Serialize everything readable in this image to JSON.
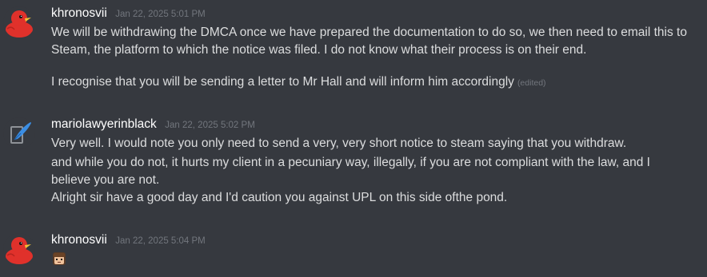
{
  "messages": [
    {
      "username": "khronosvii",
      "timestamp": "Jan 22, 2025 5:01 PM",
      "avatar_icon": "red-duck-icon",
      "lines": [
        "We will be withdrawing the DMCA once we have prepared the documentation to do so, we then need to email this to Steam, the platform to which the notice was filed. I do not know what their process is on their end.",
        "I recognise that you will be sending a letter to Mr Hall and will inform him accordingly"
      ],
      "edited_label": "(edited)"
    },
    {
      "username": "mariolawyerinblack",
      "timestamp": "Jan 22, 2025 5:02 PM",
      "avatar_icon": "quill-icon",
      "lines": [
        "Very well.  I would note you only need to send a very, very short notice to steam saying that you withdraw.",
        "and while you do not, it hurts my client in a pecuniary way, illegally, if you are not compliant with the law, and I believe you are not.",
        "Alright sir have a good day and I'd caution you against UPL on this side ofthe pond."
      ]
    },
    {
      "username": "khronosvii",
      "timestamp": "Jan 22, 2025 5:04 PM",
      "avatar_icon": "red-duck-icon",
      "emoji": "character-face-emoji"
    }
  ],
  "colors": {
    "background": "#36393f",
    "username": "#ffffff",
    "text": "#dcddde",
    "muted": "#72767d",
    "duck_red": "#e0312b"
  }
}
